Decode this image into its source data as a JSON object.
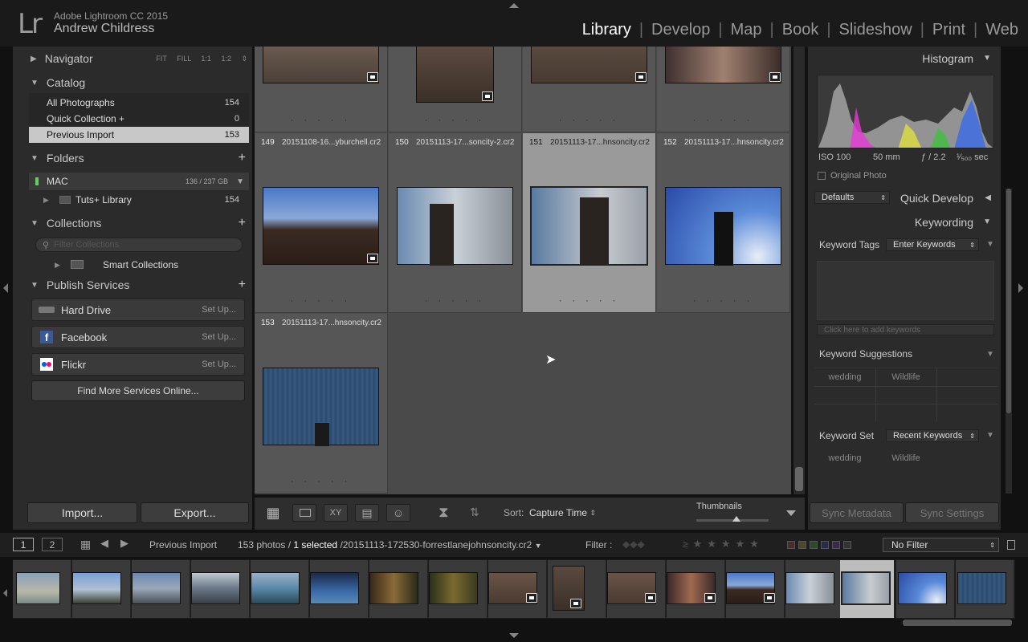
{
  "app": {
    "name": "Adobe Lightroom CC 2015",
    "logo": "Lr",
    "user": "Andrew Childress"
  },
  "modules": [
    "Library",
    "Develop",
    "Map",
    "Book",
    "Slideshow",
    "Print",
    "Web"
  ],
  "active_module": "Library",
  "left": {
    "navigator": {
      "title": "Navigator",
      "zoom": [
        "FIT",
        "FILL",
        "1:1",
        "1:2"
      ]
    },
    "catalog": {
      "title": "Catalog",
      "items": [
        {
          "label": "All Photographs",
          "count": "154"
        },
        {
          "label": "Quick Collection +",
          "count": "0"
        },
        {
          "label": "Previous Import",
          "count": "153"
        }
      ]
    },
    "folders": {
      "title": "Folders",
      "volume": "MAC",
      "volume_size": "136 / 237 GB",
      "items": [
        {
          "label": "Tuts+ Library",
          "count": "154"
        }
      ]
    },
    "collections": {
      "title": "Collections",
      "filter_placeholder": "Filter Collections",
      "items": [
        {
          "label": "Smart Collections"
        }
      ]
    },
    "publish": {
      "title": "Publish Services",
      "services": [
        {
          "label": "Hard Drive",
          "action": "Set Up..."
        },
        {
          "label": "Facebook",
          "action": "Set Up..."
        },
        {
          "label": "Flickr",
          "action": "Set Up..."
        }
      ],
      "find_more": "Find More Services Online..."
    },
    "import_label": "Import...",
    "export_label": "Export..."
  },
  "grid": {
    "cells": [
      {
        "index": "149",
        "name": "20151108-16...yburchell.cr2"
      },
      {
        "index": "150",
        "name": "20151113-17...soncity-2.cr2"
      },
      {
        "index": "151",
        "name": "20151113-17...hnsoncity.cr2"
      },
      {
        "index": "152",
        "name": "20151113-17...hnsoncity.cr2"
      },
      {
        "index": "153",
        "name": "20151113-17...hnsoncity.cr2"
      }
    ],
    "rating_dots": "· · · · ·"
  },
  "toolbar": {
    "sort_label": "Sort:",
    "sort_value": "Capture Time",
    "thumbnails_label": "Thumbnails",
    "thumb_size": 0.55
  },
  "right": {
    "histogram": {
      "title": "Histogram",
      "iso": "ISO 100",
      "focal": "50 mm",
      "aperture": "ƒ / 2.2",
      "shutter": "¹⁄₅₀₀ sec",
      "original": "Original Photo"
    },
    "quick_develop": {
      "preset": "Defaults",
      "title": "Quick Develop"
    },
    "keywording": {
      "title": "Keywording",
      "tags_label": "Keyword Tags",
      "tags_value": "Enter Keywords",
      "add_placeholder": "Click here to add keywords",
      "suggestions_label": "Keyword Suggestions",
      "suggestions": [
        "wedding",
        "Wildlife"
      ],
      "set_label": "Keyword Set",
      "set_value": "Recent Keywords",
      "set_items": [
        "wedding",
        "Wildlife"
      ]
    },
    "sync_metadata": "Sync Metadata",
    "sync_settings": "Sync Settings"
  },
  "filmstrip_bar": {
    "page1": "1",
    "page2": "2",
    "source": "Previous Import",
    "count_text": "153 photos /",
    "selected": "1 selected",
    "filename": "/20151113-172530-forrestlanejohnsoncity.cr2",
    "filter_label": "Filter :",
    "filter_value": "No Filter"
  },
  "colors": {
    "accent_selected": "#9a9a9a",
    "bg": "#111111"
  }
}
